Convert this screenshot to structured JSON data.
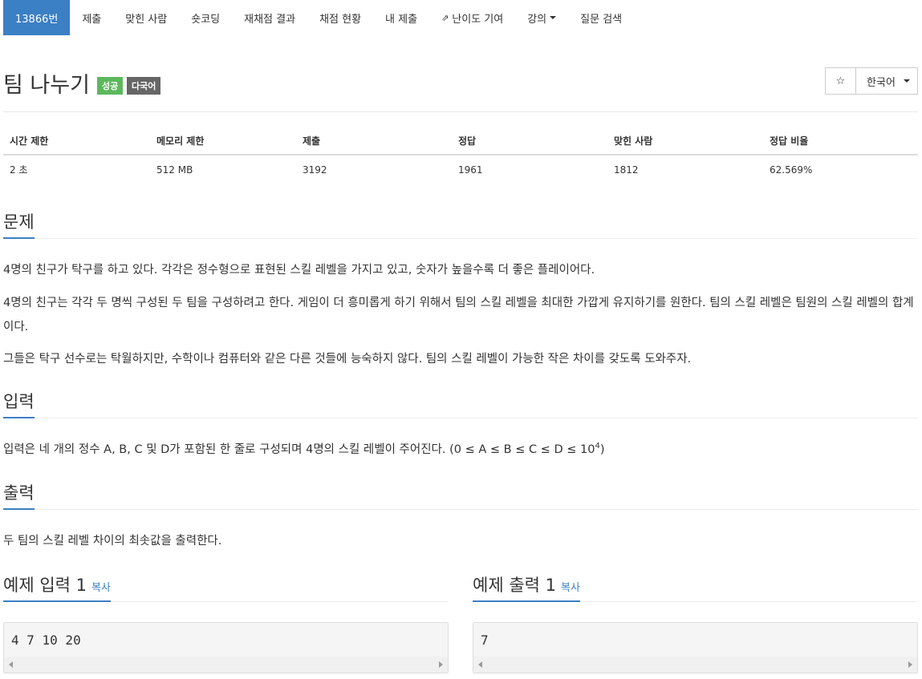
{
  "nav": {
    "items": [
      {
        "label": "13866번",
        "active": true
      },
      {
        "label": "제출"
      },
      {
        "label": "맞힌 사람"
      },
      {
        "label": "숏코딩"
      },
      {
        "label": "재채점 결과"
      },
      {
        "label": "채점 현황"
      },
      {
        "label": "내 제출"
      },
      {
        "label": "난이도 기여",
        "icon": "external-link-icon"
      },
      {
        "label": "강의",
        "dropdown": true
      },
      {
        "label": "질문 검색"
      }
    ]
  },
  "problem": {
    "title": "팀 나누기",
    "labels": {
      "success": "성공",
      "multilang": "다국어"
    },
    "star_icon": "☆",
    "language": "한국어"
  },
  "info_table": {
    "headers": [
      "시간 제한",
      "메모리 제한",
      "제출",
      "정답",
      "맞힌 사람",
      "정답 비율"
    ],
    "row": [
      "2 초",
      "512 MB",
      "3192",
      "1961",
      "1812",
      "62.569%"
    ]
  },
  "sections": {
    "description": {
      "heading": "문제",
      "paragraphs": [
        "4명의 친구가 탁구를 하고 있다. 각각은 정수형으로 표현된 스킬 레벨을 가지고 있고, 숫자가 높을수록 더 좋은 플레이어다.",
        "4명의 친구는 각각 두 명씩 구성된 두 팀을 구성하려고 한다. 게임이 더 흥미롭게 하기 위해서 팀의 스킬 레벨을 최대한 가깝게 유지하기를 원한다. 팀의 스킬 레벨은 팀원의 스킬 레벨의 합계이다.",
        "그들은 탁구 선수로는 탁월하지만, 수학이나 컴퓨터와 같은 다른 것들에 능숙하지 않다. 팀의 스킬 레벨이 가능한 작은 차이를 갖도록 도와주자."
      ]
    },
    "input": {
      "heading": "입력",
      "text": "입력은 네 개의 정수 A, B, C 및 D가 포함된 한 줄로 구성되며 4명의 스킬 레벨이 주어진다. (0 ≤ A ≤ B ≤ C ≤ D ≤ 10",
      "sup": "4",
      "text_end": ")"
    },
    "output": {
      "heading": "출력",
      "text": "두 팀의 스킬 레벨 차이의 최솟값을 출력한다."
    }
  },
  "samples": {
    "input": {
      "heading": "예제 입력 1",
      "copy": "복사",
      "data": "4 7 10 20"
    },
    "output": {
      "heading": "예제 출력 1",
      "copy": "복사",
      "data": "7"
    }
  },
  "colors": {
    "primary": "#3b7fc4",
    "success": "#5cb85c",
    "default": "#666666"
  }
}
